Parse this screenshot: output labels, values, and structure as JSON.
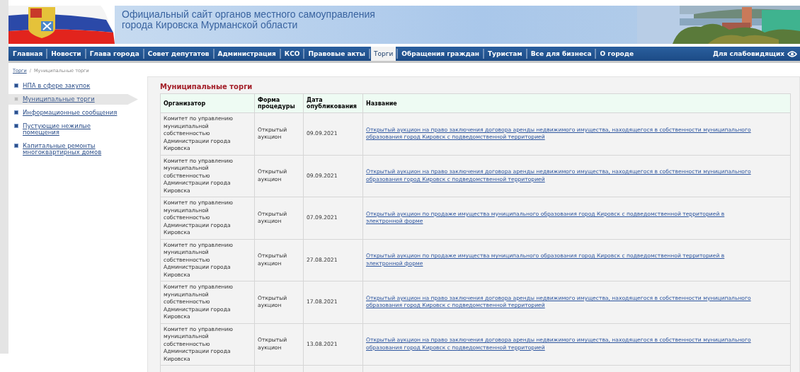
{
  "header": {
    "title_line_1": "Официальный сайт органов местного самоуправления",
    "title_line_2": "города Кировска Мурманской области"
  },
  "nav": {
    "items": [
      {
        "label": "Главная",
        "selected": false
      },
      {
        "label": "Новости",
        "selected": false
      },
      {
        "label": "Глава города",
        "selected": false
      },
      {
        "label": "Совет депутатов",
        "selected": false
      },
      {
        "label": "Администрация",
        "selected": false
      },
      {
        "label": "КСО",
        "selected": false
      },
      {
        "label": "Правовые акты",
        "selected": false
      },
      {
        "label": "Торги",
        "selected": true
      },
      {
        "label": "Обращения граждан",
        "selected": false
      },
      {
        "label": "Туристам",
        "selected": false
      },
      {
        "label": "Все для бизнеса",
        "selected": false
      },
      {
        "label": "О городе",
        "selected": false
      }
    ],
    "accessibility_link": "Для слабовидящих"
  },
  "breadcrumb": {
    "link": "Торги",
    "separator": "/",
    "current": "Муниципальные торги"
  },
  "sidebar": {
    "items": [
      {
        "label": "НПА в сфере закупок",
        "selected": false
      },
      {
        "label": "Муниципальные торги",
        "selected": true
      },
      {
        "label": "Информационные сообщения",
        "selected": false
      },
      {
        "label": "Пустующие нежилые помещения",
        "selected": false
      },
      {
        "label": "Капитальные ремонты многоквартирных домов",
        "selected": false
      }
    ]
  },
  "content": {
    "title": "Муниципальные торги",
    "table": {
      "columns": [
        "Организатор",
        "Форма процедуры",
        "Дата опубликования",
        "Название"
      ],
      "rows": [
        {
          "organizer": "Комитет по управлению муниципальной собственностью Администрации города Кировска",
          "form": "Открытый аукцион",
          "date": "09.09.2021",
          "name": "Открытый аукцион на право заключения договора аренды недвижимого имущества, находящегося в собственности муниципального образования город Кировск с подведомственной территорией"
        },
        {
          "organizer": "Комитет по управлению муниципальной собственностью Администрации города Кировска",
          "form": "Открытый аукцион",
          "date": "09.09.2021",
          "name": "Открытый аукцион на право заключения договора аренды недвижимого имущества, находящегося в собственности муниципального образования город Кировск с подведомственной территорией"
        },
        {
          "organizer": "Комитет по управлению муниципальной собственностью Администрации города Кировска",
          "form": "Открытый аукцион",
          "date": "07.09.2021",
          "name": "Открытый аукцион по продаже имущества муниципального образования город Кировск с подведомственной территорией в электронной форме"
        },
        {
          "organizer": "Комитет по управлению муниципальной собственностью Администрации города Кировска",
          "form": "Открытый аукцион",
          "date": "27.08.2021",
          "name": "Открытый аукцион по продаже имущества муниципального образования город Кировск с подведомственной территорией в электронной форме"
        },
        {
          "organizer": "Комитет по управлению муниципальной собственностью Администрации города Кировска",
          "form": "Открытый аукцион",
          "date": "17.08.2021",
          "name": "Открытый аукцион на право заключения договора аренды недвижимого имущества, находящегося в собственности муниципального образования город Кировск с подведомственной территорией"
        },
        {
          "organizer": "Комитет по управлению муниципальной собственностью Администрации города Кировска",
          "form": "Открытый аукцион",
          "date": "13.08.2021",
          "name": "Открытый аукцион на право заключения договора аренды недвижимого имущества, находящегося в собственности муниципального образования город Кировск с подведомственной территорией"
        }
      ]
    }
  }
}
